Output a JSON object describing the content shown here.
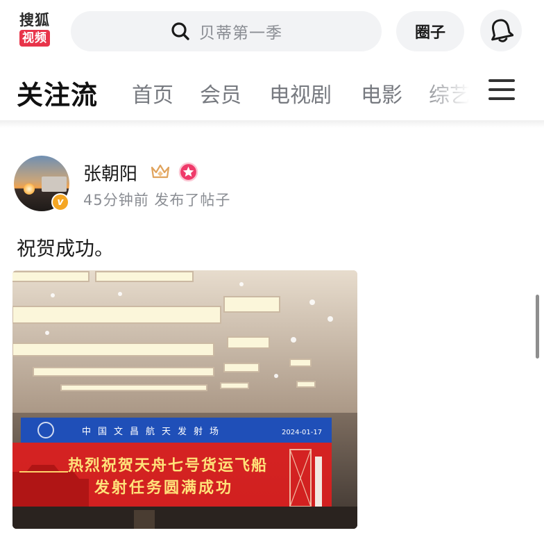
{
  "header": {
    "logo_top": "搜狐",
    "logo_bottom": "视频",
    "search_placeholder": "贝蒂第一季",
    "circle_label": "圈子"
  },
  "tabs": {
    "active": "关注流",
    "items": [
      "首页",
      "会员",
      "电视剧",
      "电影",
      "综艺"
    ]
  },
  "post": {
    "author": "张朝阳",
    "verified_mark": "v",
    "time": "45分钟前",
    "action": "发布了帖子",
    "text": "祝贺成功。",
    "image": {
      "screen_header_left": "中国文昌航天发射场",
      "screen_header_right": "2024-01-17",
      "screen_line1": "热烈祝贺天舟七号货运飞船",
      "screen_line2": "发射任务圆满成功"
    }
  },
  "colors": {
    "brand_red": "#e8344a",
    "verified_orange": "#f5a623",
    "badge_pink": "#ef3a6a",
    "screen_blue": "#1f4fb8",
    "screen_red": "#d91f1f",
    "screen_text_gold": "#ffe27a"
  }
}
